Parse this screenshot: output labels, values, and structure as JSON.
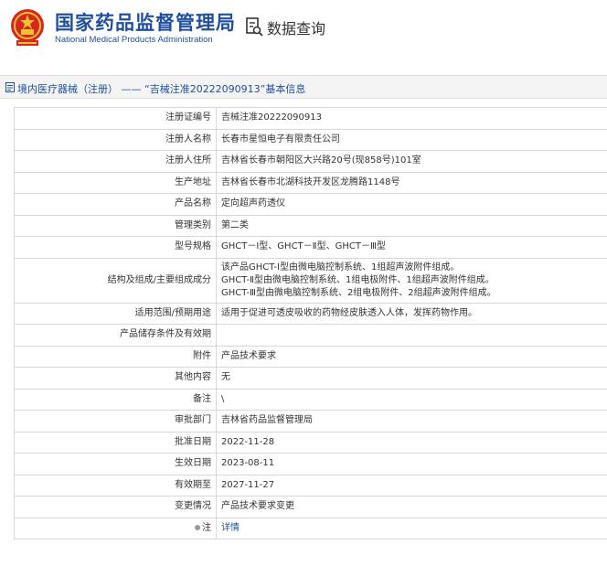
{
  "header": {
    "title_cn": "国家药品监督管理局",
    "title_en": "National Medical Products Administration",
    "query_title": "数据查询"
  },
  "breadcrumb": {
    "text": "境内医疗器械（注册） —— “吉械注准20222090913”基本信息"
  },
  "colors": {
    "brand_blue": "#1f4fa0",
    "emblem_red": "#d7261e",
    "emblem_gold": "#f2c230"
  },
  "rows": [
    {
      "label": "注册证编号",
      "value": "吉械注准20222090913"
    },
    {
      "label": "注册人名称",
      "value": "长春市星恒电子有限责任公司"
    },
    {
      "label": "注册人住所",
      "value": "吉林省长春市朝阳区大兴路20号(现858号)101室"
    },
    {
      "label": "生产地址",
      "value": "吉林省长春市北湖科技开发区龙腾路1148号"
    },
    {
      "label": "产品名称",
      "value": "定向超声药透仪"
    },
    {
      "label": "管理类别",
      "value": "第二类"
    },
    {
      "label": "型号规格",
      "value": "GHCT－Ⅰ型、GHCT－Ⅱ型、GHCT－Ⅲ型"
    },
    {
      "label": "结构及组成/主要组成成分",
      "lines": [
        "该产品GHCT-Ⅰ型由微电脑控制系统、1组超声波附件组成。",
        "GHCT-Ⅱ型由微电脑控制系统、1组电极附件、1组超声波附件组成。",
        "GHCT-Ⅲ型由微电脑控制系统、2组电极附件、2组超声波附件组成。"
      ]
    },
    {
      "label": "适用范围/预期用途",
      "value": "适用于促进可透皮吸收的药物经皮肤透入人体，发挥药物作用。"
    },
    {
      "label": "产品储存条件及有效期",
      "value": ""
    },
    {
      "label": "附件",
      "value": "产品技术要求"
    },
    {
      "label": "其他内容",
      "value": "无"
    },
    {
      "label": "备注",
      "value": "\\"
    },
    {
      "label": "审批部门",
      "value": "吉林省药品监督管理局"
    },
    {
      "label": "批准日期",
      "value": "2022-11-28"
    },
    {
      "label": "生效日期",
      "value": "2023-08-11"
    },
    {
      "label": "有效期至",
      "value": "2027-11-27"
    },
    {
      "label": "变更情况",
      "value": "产品技术要求变更"
    },
    {
      "label": "注",
      "value": "详情"
    }
  ]
}
